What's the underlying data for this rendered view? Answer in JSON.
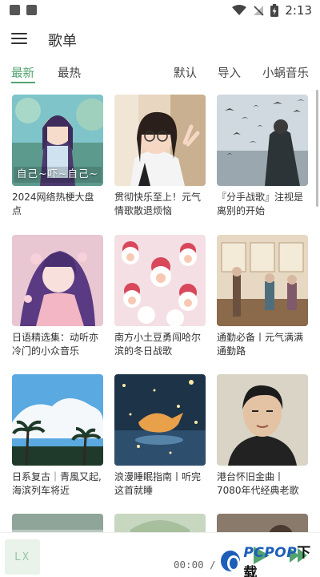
{
  "status_bar": {
    "time": "2:13"
  },
  "app_bar": {
    "title": "歌单"
  },
  "tabs": {
    "latest": "最新",
    "hot": "最热",
    "default": "默认",
    "import": "导入",
    "source": "小蜗音乐"
  },
  "playlists": [
    {
      "title": "2024网络热梗大盘点",
      "cover_text": "自己~吓~自己~"
    },
    {
      "title": "贯彻快乐至上！元气情歌散退烦恼"
    },
    {
      "title": "『分手战歌』注视是离别的开始"
    },
    {
      "title": "日语精选集：动听亦冷门的小众音乐"
    },
    {
      "title": "南方小土豆勇闯哈尔滨的冬日战歌"
    },
    {
      "title": "通勤必备丨元气满满通勤路"
    },
    {
      "title": "日系复古｜青風又起,海滨列车将近"
    },
    {
      "title": "浪漫睡眠指南丨听完这首就睡"
    },
    {
      "title": "港台怀旧金曲丨7080年代经典老歌"
    }
  ],
  "player": {
    "art_text": "LX",
    "time": "00:00 / 00"
  },
  "watermark": {
    "brand_a": "PCPOP",
    "brand_b": "下载"
  },
  "colors": {
    "accent": "#52a36f"
  }
}
